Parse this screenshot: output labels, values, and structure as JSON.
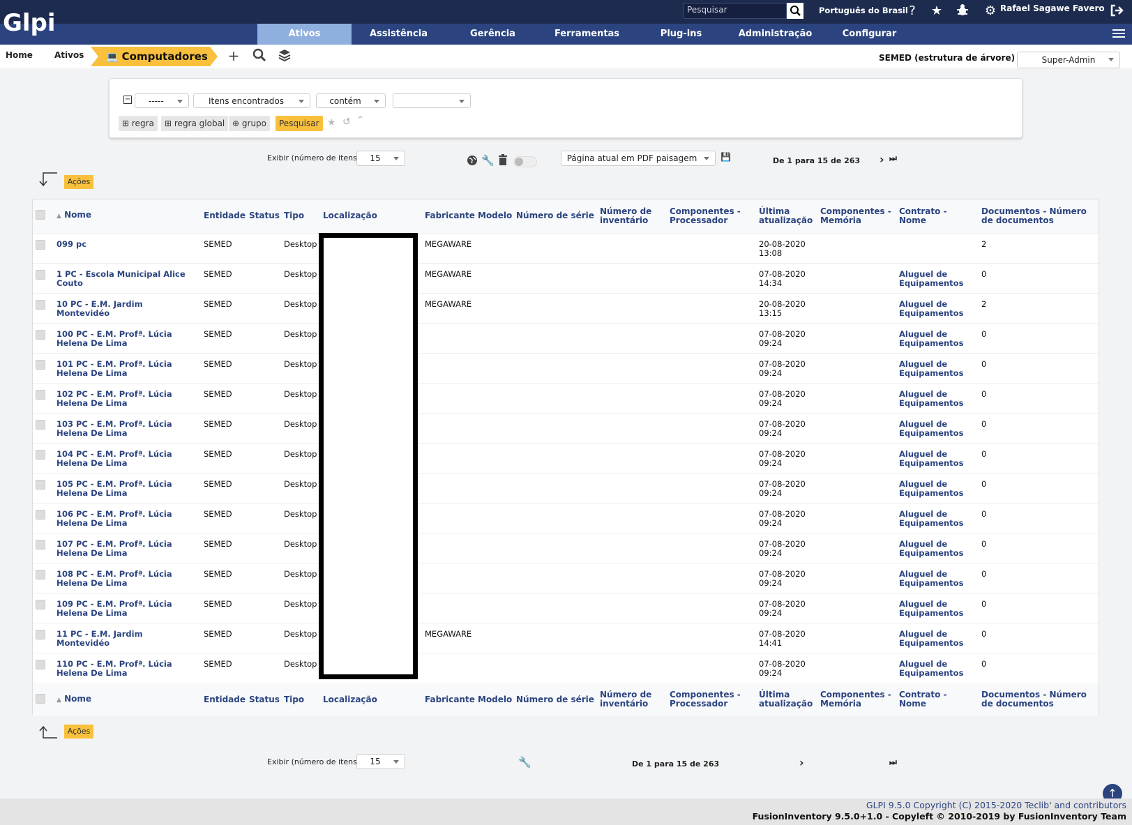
{
  "header": {
    "logo": "Glpi",
    "search_placeholder": "Pesquisar",
    "language": "Português do Brasil",
    "user": "Rafael Sagawe Favero"
  },
  "menu": [
    "Ativos",
    "Assistência",
    "Gerência",
    "Ferramentas",
    "Plug-ins",
    "Administração",
    "Configurar"
  ],
  "breadcrumb": {
    "home": "Home",
    "assets": "Ativos",
    "current": "Computadores"
  },
  "entity": "SEMED (estrutura de árvore)",
  "profile": "Super-Admin",
  "search": {
    "field1": "-----",
    "field2": "Itens encontrados",
    "operator": "contém",
    "value": "",
    "btn_rule": "regra",
    "btn_global_rule": "regra global",
    "btn_group": "grupo",
    "btn_search": "Pesquisar"
  },
  "pager_top": {
    "show_label": "Exibir (número de itens)",
    "per_page": "15",
    "export": "Página atual em PDF paisagem",
    "range": "De 1 para 15 de 263"
  },
  "actions_label": "Ações",
  "columns": [
    "Nome",
    "Entidade",
    "Status",
    "Tipo",
    "Localização",
    "Fabricante",
    "Modelo",
    "Número de série",
    "Número de inventário",
    "Componentes - Processador",
    "Última atualização",
    "Componentes - Memória",
    "Contrato - Nome",
    "Documentos - Número de documentos"
  ],
  "rows": [
    {
      "name": "099 pc",
      "entity": "SEMED",
      "type": "Desktop",
      "manufacturer": "MEGAWARE",
      "updated": "20-08-2020 13:08",
      "contract": "",
      "docs": "2"
    },
    {
      "name": "1 PC - Escola Municipal Alice Couto",
      "entity": "SEMED",
      "type": "Desktop",
      "manufacturer": "MEGAWARE",
      "updated": "07-08-2020 14:34",
      "contract": "Aluguel de Equipamentos",
      "docs": "0"
    },
    {
      "name": "10 PC - E.M. Jardim Montevidéo",
      "entity": "SEMED",
      "type": "Desktop",
      "manufacturer": "MEGAWARE",
      "updated": "20-08-2020 13:15",
      "contract": "Aluguel de Equipamentos",
      "docs": "2"
    },
    {
      "name": "100 PC - E.M. Profª. Lúcia Helena De Lima",
      "entity": "SEMED",
      "type": "Desktop",
      "manufacturer": "",
      "updated": "07-08-2020 09:24",
      "contract": "Aluguel de Equipamentos",
      "docs": "0"
    },
    {
      "name": "101 PC - E.M. Profª. Lúcia Helena De Lima",
      "entity": "SEMED",
      "type": "Desktop",
      "manufacturer": "",
      "updated": "07-08-2020 09:24",
      "contract": "Aluguel de Equipamentos",
      "docs": "0"
    },
    {
      "name": "102 PC - E.M. Profª. Lúcia Helena De Lima",
      "entity": "SEMED",
      "type": "Desktop",
      "manufacturer": "",
      "updated": "07-08-2020 09:24",
      "contract": "Aluguel de Equipamentos",
      "docs": "0"
    },
    {
      "name": "103 PC - E.M. Profª. Lúcia Helena De Lima",
      "entity": "SEMED",
      "type": "Desktop",
      "manufacturer": "",
      "updated": "07-08-2020 09:24",
      "contract": "Aluguel de Equipamentos",
      "docs": "0"
    },
    {
      "name": "104 PC - E.M. Profª. Lúcia Helena De Lima",
      "entity": "SEMED",
      "type": "Desktop",
      "manufacturer": "",
      "updated": "07-08-2020 09:24",
      "contract": "Aluguel de Equipamentos",
      "docs": "0"
    },
    {
      "name": "105 PC - E.M. Profª. Lúcia Helena De Lima",
      "entity": "SEMED",
      "type": "Desktop",
      "manufacturer": "",
      "updated": "07-08-2020 09:24",
      "contract": "Aluguel de Equipamentos",
      "docs": "0"
    },
    {
      "name": "106 PC - E.M. Profª. Lúcia Helena De Lima",
      "entity": "SEMED",
      "type": "Desktop",
      "manufacturer": "",
      "updated": "07-08-2020 09:24",
      "contract": "Aluguel de Equipamentos",
      "docs": "0"
    },
    {
      "name": "107 PC - E.M. Profª. Lúcia Helena De Lima",
      "entity": "SEMED",
      "type": "Desktop",
      "manufacturer": "",
      "updated": "07-08-2020 09:24",
      "contract": "Aluguel de Equipamentos",
      "docs": "0"
    },
    {
      "name": "108 PC - E.M. Profª. Lúcia Helena De Lima",
      "entity": "SEMED",
      "type": "Desktop",
      "manufacturer": "",
      "updated": "07-08-2020 09:24",
      "contract": "Aluguel de Equipamentos",
      "docs": "0"
    },
    {
      "name": "109 PC - E.M. Profª. Lúcia Helena De Lima",
      "entity": "SEMED",
      "type": "Desktop",
      "manufacturer": "",
      "updated": "07-08-2020 09:24",
      "contract": "Aluguel de Equipamentos",
      "docs": "0"
    },
    {
      "name": "11 PC - E.M. Jardim Montevidéo",
      "entity": "SEMED",
      "type": "Desktop",
      "manufacturer": "MEGAWARE",
      "updated": "07-08-2020 14:41",
      "contract": "Aluguel de Equipamentos",
      "docs": "0"
    },
    {
      "name": "110 PC - E.M. Profª. Lúcia Helena De Lima",
      "entity": "SEMED",
      "type": "Desktop",
      "manufacturer": "",
      "updated": "07-08-2020 09:24",
      "contract": "Aluguel de Equipamentos",
      "docs": "0"
    }
  ],
  "pager_bottom": {
    "show_label": "Exibir (número de itens)",
    "per_page": "15",
    "range": "De 1 para 15 de 263"
  },
  "footer": {
    "line1": "GLPI 9.5.0 Copyright (C) 2015-2020 Teclib' and contributors",
    "line2": "FusionInventory 9.5.0+1.0 - Copyleft © 2010-2019 by FusionInventory Team"
  },
  "colors": {
    "navy": "#1d2b4f",
    "menu": "#2b4480",
    "accent": "#f8c03c",
    "active_menu": "#8fb0de"
  }
}
